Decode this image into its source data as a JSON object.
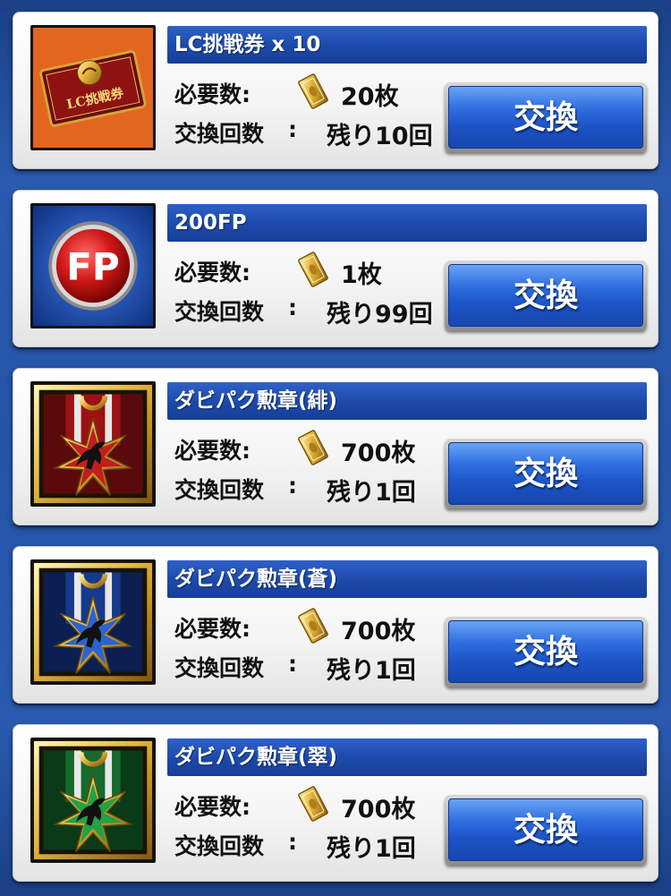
{
  "labels": {
    "required": "必要数:",
    "exchange_count": "交換回数",
    "colon": ":",
    "button": "交換"
  },
  "items": [
    {
      "title": "LC挑戦券 x 10",
      "required": "20枚",
      "remaining": "残り10回",
      "icon": "lc-ticket-icon",
      "ticket_text": "LC挑戦券"
    },
    {
      "title": "200FP",
      "required": "1枚",
      "remaining": "残り99回",
      "icon": "fp-coin-icon",
      "coin_text": "FP"
    },
    {
      "title": "ダビパク勲章(緋)",
      "required": "700枚",
      "remaining": "残り1回",
      "icon": "red-medal-icon"
    },
    {
      "title": "ダビパク勲章(蒼)",
      "required": "700枚",
      "remaining": "残り1回",
      "icon": "blue-medal-icon"
    },
    {
      "title": "ダビパク勲章(翠)",
      "required": "700枚",
      "remaining": "残り1回",
      "icon": "green-medal-icon"
    }
  ],
  "colors": {
    "title_bar": "#1c49aa",
    "button": "#1c53c6",
    "background": "#2453a8",
    "medal_red": "#8b1111",
    "medal_blue": "#0f2f7a",
    "medal_green": "#0f5a25"
  }
}
